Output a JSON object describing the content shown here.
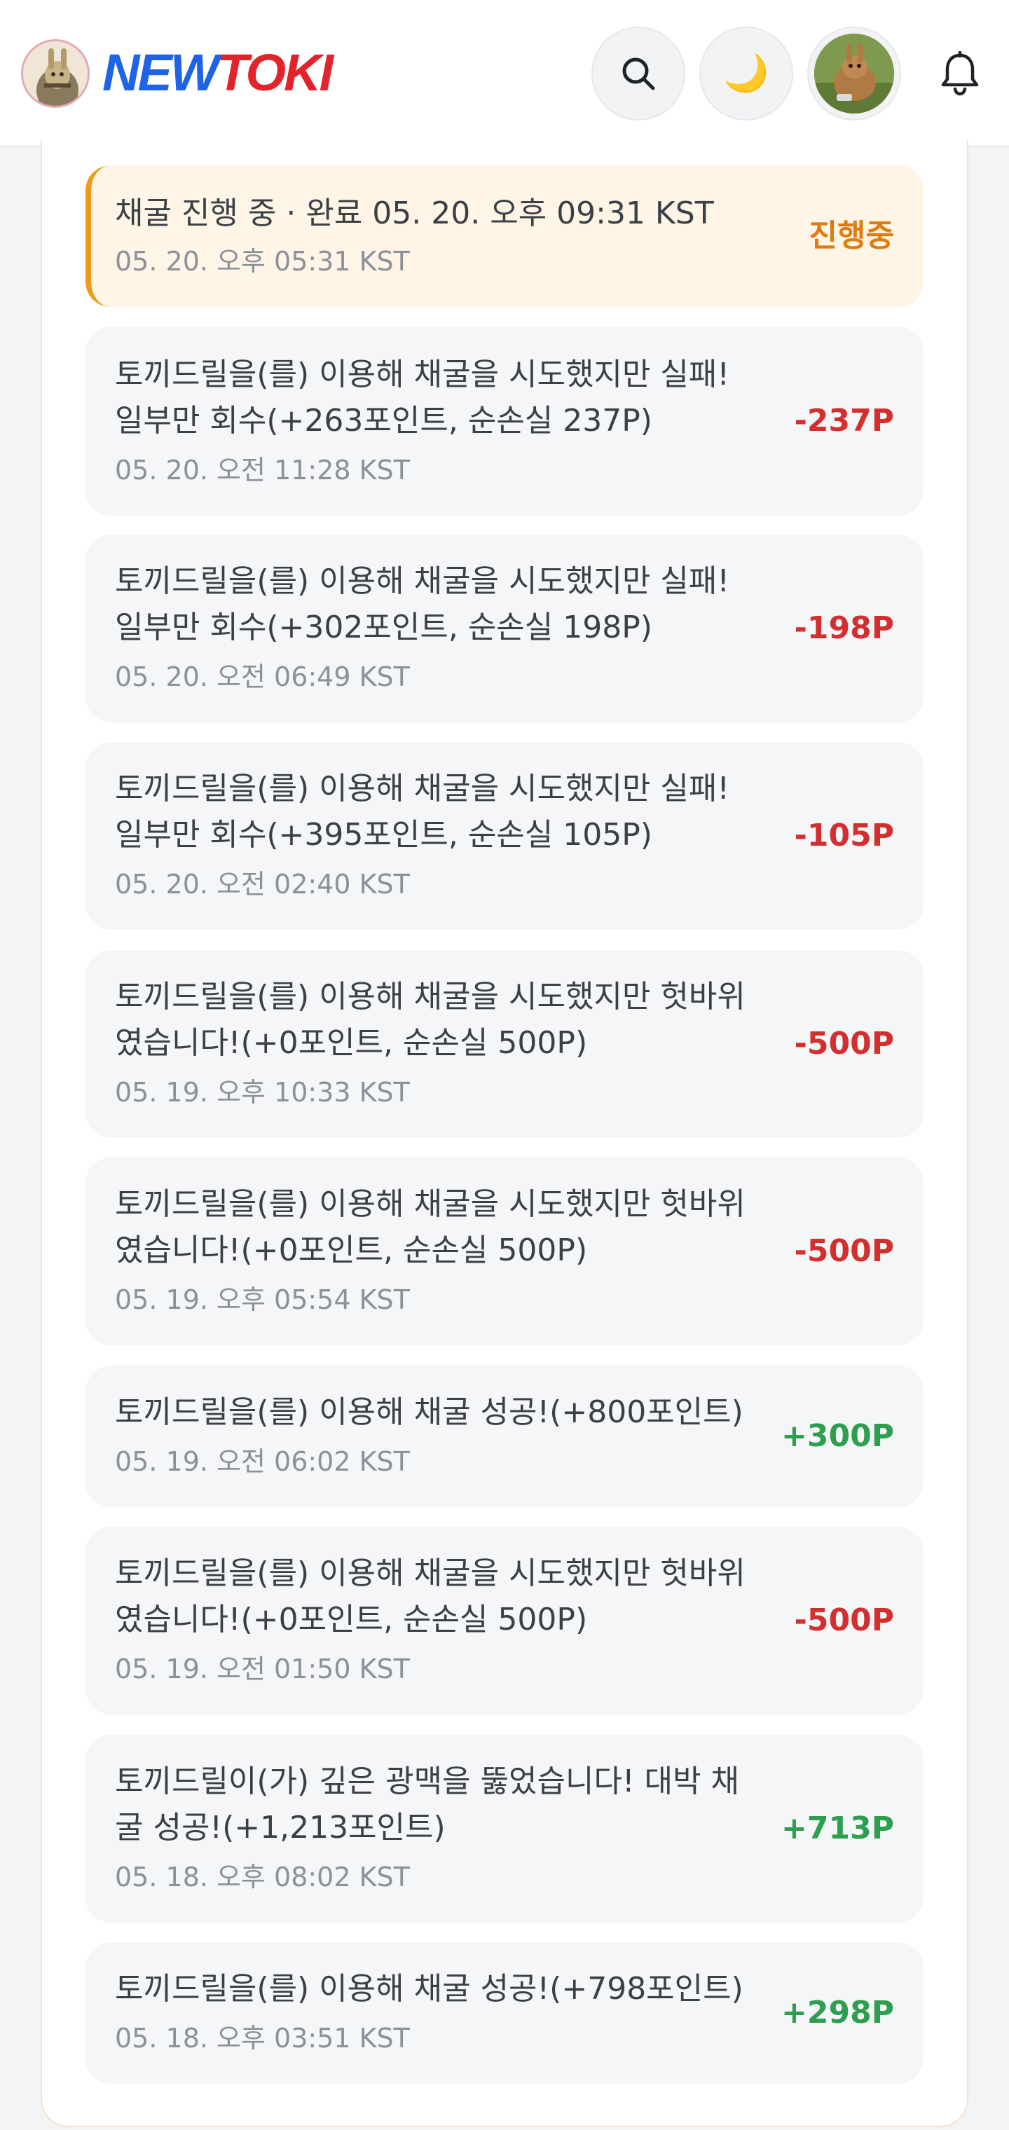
{
  "header": {
    "logo_new": "NEW",
    "logo_toki": "TOKI",
    "icons": {
      "search": "search-icon",
      "theme": "moon-icon",
      "notifications": "bell-icon"
    },
    "theme_glyph": "🌙"
  },
  "colors": {
    "accent_blue": "#1f64e6",
    "accent_red": "#e3232b",
    "loss": "#d32f2f",
    "gain": "#2e9e4f",
    "pending": "#e07b0e",
    "pending_border": "#ee9a1a"
  },
  "entries": [
    {
      "line1": "채굴 진행 중 · 완료 05. 20. 오후 09:31 KST",
      "line2": "",
      "time": "05. 20. 오후 05:31 KST",
      "amount": "진행중",
      "kind": "pending"
    },
    {
      "line1": "토끼드릴을(를) 이용해 채굴을 시도했지만 실패!",
      "line2": "일부만 회수(+263포인트, 순손실 237P)",
      "time": "05. 20. 오전 11:28 KST",
      "amount": "-237P",
      "kind": "loss"
    },
    {
      "line1": "토끼드릴을(를) 이용해 채굴을 시도했지만 실패!",
      "line2": "일부만 회수(+302포인트, 순손실 198P)",
      "time": "05. 20. 오전 06:49 KST",
      "amount": "-198P",
      "kind": "loss"
    },
    {
      "line1": "토끼드릴을(를) 이용해 채굴을 시도했지만 실패!",
      "line2": "일부만 회수(+395포인트, 순손실 105P)",
      "time": "05. 20. 오전 02:40 KST",
      "amount": "-105P",
      "kind": "loss"
    },
    {
      "line1": "토끼드릴을(를) 이용해 채굴을 시도했지만 헛바위",
      "line2": "였습니다!(+0포인트, 순손실 500P)",
      "time": "05. 19. 오후 10:33 KST",
      "amount": "-500P",
      "kind": "loss"
    },
    {
      "line1": "토끼드릴을(를) 이용해 채굴을 시도했지만 헛바위",
      "line2": "였습니다!(+0포인트, 순손실 500P)",
      "time": "05. 19. 오후 05:54 KST",
      "amount": "-500P",
      "kind": "loss"
    },
    {
      "line1": "토끼드릴을(를) 이용해 채굴 성공!(+800포인트)",
      "line2": "",
      "time": "05. 19. 오전 06:02 KST",
      "amount": "+300P",
      "kind": "gain"
    },
    {
      "line1": "토끼드릴을(를) 이용해 채굴을 시도했지만 헛바위",
      "line2": "였습니다!(+0포인트, 순손실 500P)",
      "time": "05. 19. 오전 01:50 KST",
      "amount": "-500P",
      "kind": "loss"
    },
    {
      "line1": "토끼드릴이(가) 깊은 광맥을 뚫었습니다! 대박 채",
      "line2": "굴 성공!(+1,213포인트)",
      "time": "05. 18. 오후 08:02 KST",
      "amount": "+713P",
      "kind": "gain"
    },
    {
      "line1": "토끼드릴을(를) 이용해 채굴 성공!(+798포인트)",
      "line2": "",
      "time": "05. 18. 오후 03:51 KST",
      "amount": "+298P",
      "kind": "gain"
    }
  ]
}
